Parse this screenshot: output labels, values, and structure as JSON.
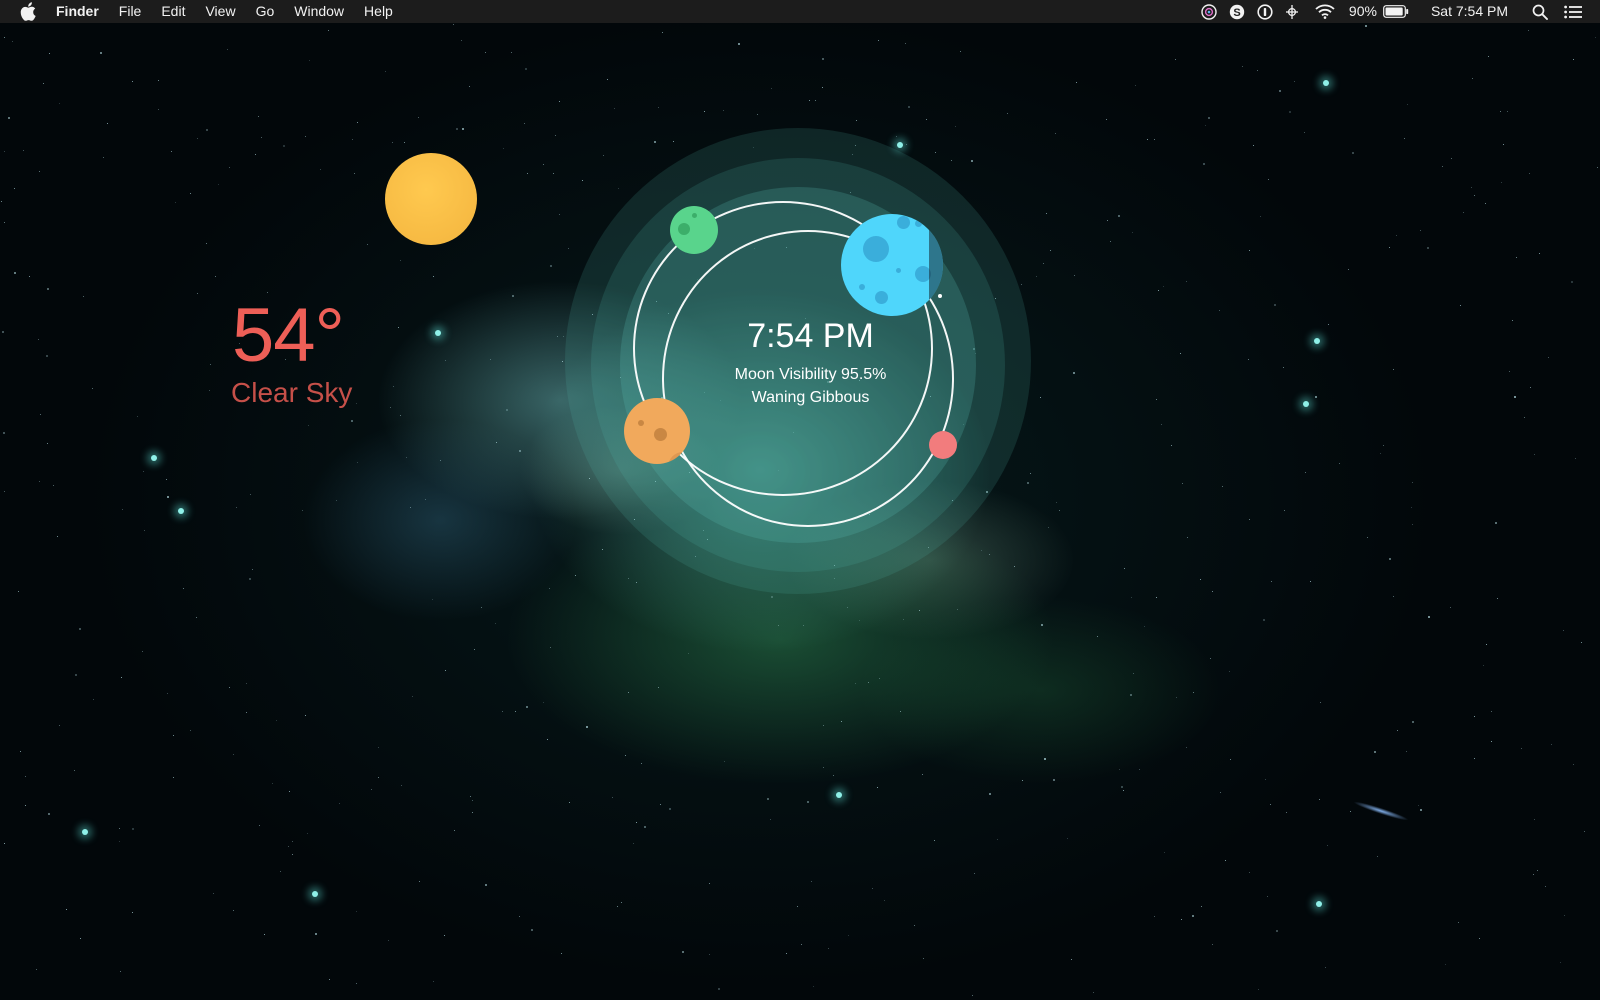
{
  "menubar": {
    "apple_icon": "apple-logo-icon",
    "app_name": "Finder",
    "menus": [
      "File",
      "Edit",
      "View",
      "Go",
      "Window",
      "Help"
    ],
    "status_icons": [
      "siri-icon",
      "skype-icon",
      "onepassword-icon",
      "airserver-icon",
      "wifi-icon"
    ],
    "battery_percent": "90%",
    "battery_icon": "battery-icon",
    "clock": "Sat 7:54 PM",
    "spotlight_icon": "search-icon",
    "notification_icon": "notification-center-icon"
  },
  "weather": {
    "temperature": "54°",
    "condition": "Clear Sky",
    "temp_color": "#ee5f57",
    "sun_color": "#f6b940"
  },
  "moon_widget": {
    "time": "7:54 PM",
    "visibility": "Moon Visibility 95.5%",
    "phase": "Waning Gibbous",
    "planet_colors": {
      "blue": "#4fd6fb",
      "green": "#59d48c",
      "orange": "#f1a95c",
      "red": "#f27c7d"
    }
  }
}
